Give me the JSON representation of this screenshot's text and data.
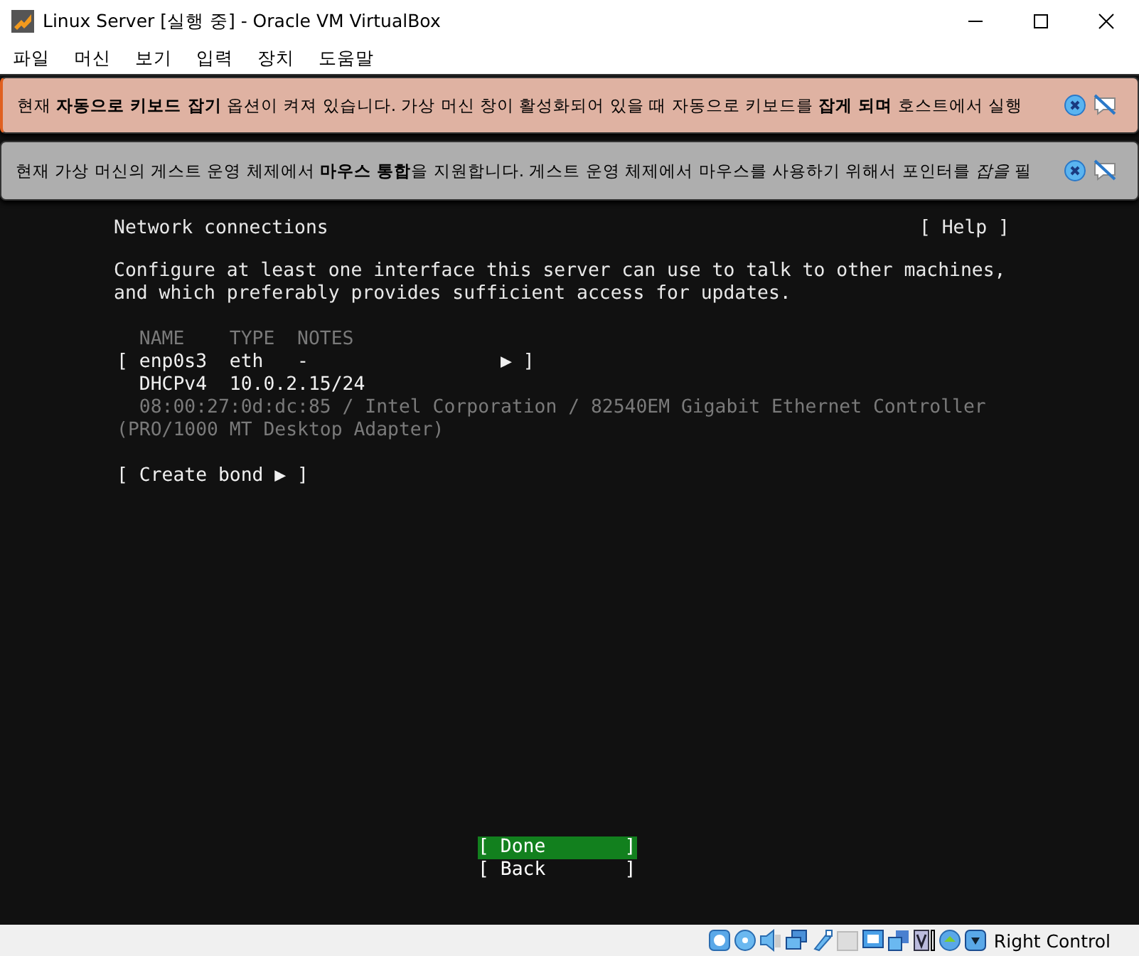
{
  "window": {
    "title": "Linux Server [실행 중] - Oracle VM VirtualBox"
  },
  "menu": [
    "파일",
    "머신",
    "보기",
    "입력",
    "장치",
    "도움말"
  ],
  "banners": [
    {
      "kind": "keyboard",
      "text": "현재 **자동으로 키보드 잡기** 옵션이 켜져 있습니다. 가상 머신 창이 활성화되어 있을 때 자동으로 키보드를 **잡게 되며** 호스트에서 실행"
    },
    {
      "kind": "mouse",
      "text": "현재 가상 머신의 게스트 운영 체제에서 **마우스 통합**을 지원합니다. 게스트 운영 체제에서 마우스를 사용하기 위해서 포인터를 *잡을* 필"
    }
  ],
  "terminal": {
    "title": "Network connections",
    "help": "[ Help ]",
    "intro": [
      "Configure at least one interface this server can use to talk to other machines,",
      "and which preferably provides sufficient access for updates."
    ],
    "lines": [
      {
        "kind": "dim",
        "text": "  NAME    TYPE  NOTES"
      },
      {
        "kind": "normal",
        "text": "[ enp0s3  eth   -                 ▶ ]"
      },
      {
        "kind": "normal",
        "text": "  DHCPv4  10.0.2.15/24"
      },
      {
        "kind": "dim",
        "text": "  08:00:27:0d:dc:85 / Intel Corporation / 82540EM Gigabit Ethernet Controller"
      },
      {
        "kind": "dim",
        "text": "(PRO/1000 MT Desktop Adapter)"
      },
      {
        "kind": "action",
        "text": "[ Create bond ▶ ]"
      }
    ],
    "buttons": [
      {
        "text": "[ Done       ]",
        "selected": true
      },
      {
        "text": "[ Back       ]",
        "selected": false
      }
    ]
  },
  "status_bar": {
    "host_key": "Right Control"
  }
}
